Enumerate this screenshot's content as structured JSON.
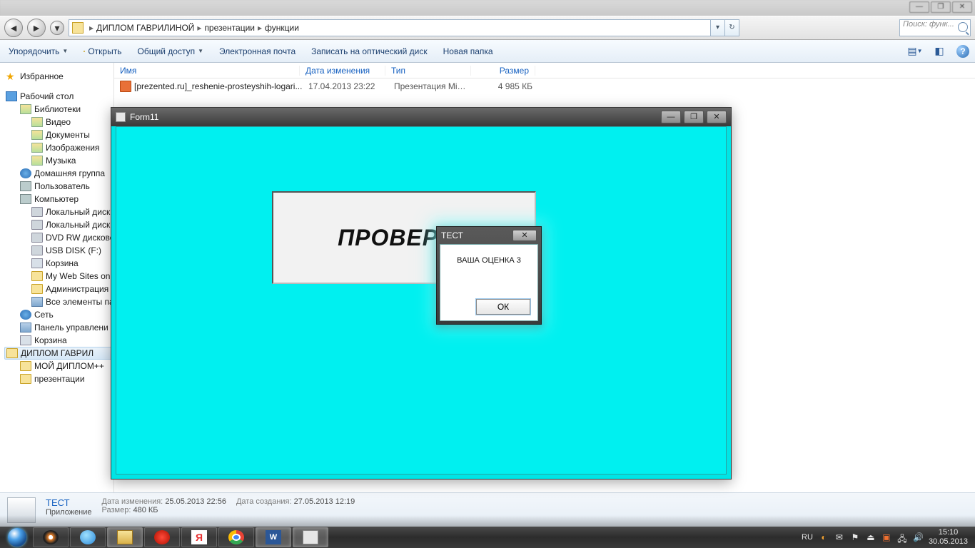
{
  "window_controls": {
    "min": "—",
    "max": "❐",
    "close": "✕"
  },
  "breadcrumb": {
    "p1": "ДИПЛОМ ГАВРИЛИНОЙ",
    "p2": "презентации",
    "p3": "функции",
    "sep": "▸"
  },
  "search": {
    "placeholder": "Поиск: функ..."
  },
  "toolbar": {
    "organize": "Упорядочить",
    "open": "Открыть",
    "share": "Общий доступ",
    "email": "Электронная почта",
    "burn": "Записать на оптический диск",
    "newfolder": "Новая папка"
  },
  "columns": {
    "name": "Имя",
    "date": "Дата изменения",
    "type": "Тип",
    "size": "Размер"
  },
  "files": [
    {
      "name": "[prezented.ru]_reshenie-prosteyshih-logari...",
      "date": "17.04.2013 23:22",
      "type": "Презентация Micr...",
      "size": "4 985 КБ"
    }
  ],
  "sidebar": {
    "favorites": "Избранное",
    "desktop": "Рабочий стол",
    "libraries": "Библиотеки",
    "video": "Видео",
    "documents": "Документы",
    "images": "Изображения",
    "music": "Музыка",
    "homegroup": "Домашняя группа",
    "user": "Пользователь",
    "computer": "Компьютер",
    "localdisk": "Локальный диск",
    "dvdrw": "DVD RW дисково",
    "usb": "USB DISK (F:)",
    "bin": "Корзина",
    "mysites": "My Web Sites on",
    "admin": "Администрация",
    "allitems": "Все элементы па",
    "network": "Сеть",
    "cpanel": "Панель управлени",
    "bin2": "Корзина",
    "diplom": "ДИПЛОМ ГАВРИЛ",
    "mydiplom": "МОЙ ДИПЛОМ++",
    "presentations": "презентации"
  },
  "details": {
    "title": "ТЕСТ",
    "apptype": "Приложение",
    "modified_label": "Дата изменения:",
    "modified": "25.05.2013 22:56",
    "size_label": "Размер:",
    "size": "480 КБ",
    "created_label": "Дата создания:",
    "created": "27.05.2013 12:19"
  },
  "form11": {
    "title": "Form11",
    "check_label": "ПРОВЕРКА"
  },
  "msgbox": {
    "title": "ТЕСТ",
    "text": "ВАША ОЦЕНКА 3",
    "ok": "ОК"
  },
  "tray": {
    "lang": "RU",
    "time": "15:10",
    "date": "30.05.2013"
  },
  "yandex_letter": "Я",
  "word_letter": "W"
}
